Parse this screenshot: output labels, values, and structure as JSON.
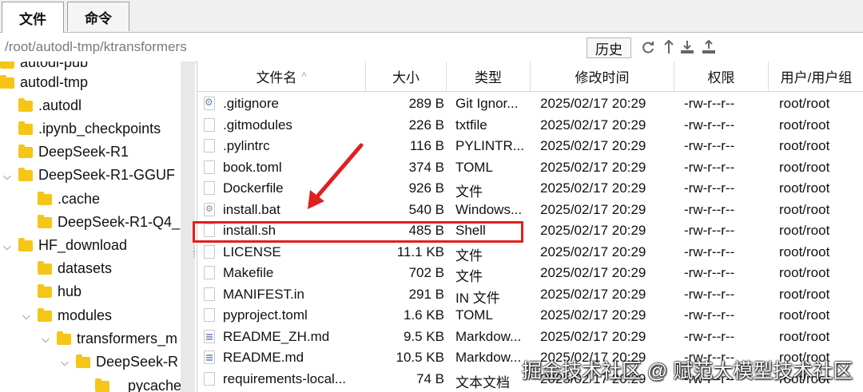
{
  "tabs": [
    {
      "label": "文件",
      "active": true
    },
    {
      "label": "命令",
      "active": false
    }
  ],
  "path": {
    "value": "/root/autodl-tmp/ktransformers",
    "history_label": "历史",
    "toolbar_icons": [
      "refresh-icon",
      "up-arrow-icon",
      "download-icon",
      "upload-icon"
    ]
  },
  "tree": {
    "items": [
      {
        "label": "autodl-pub"
      },
      {
        "label": "autodl-tmp"
      },
      {
        "label": ".autodl"
      },
      {
        "label": ".ipynb_checkpoints"
      },
      {
        "label": "DeepSeek-R1"
      },
      {
        "label": "DeepSeek-R1-GGUF"
      },
      {
        "label": ".cache"
      },
      {
        "label": "DeepSeek-R1-Q4_"
      },
      {
        "label": "HF_download"
      },
      {
        "label": "datasets"
      },
      {
        "label": "hub"
      },
      {
        "label": "modules"
      },
      {
        "label": "transformers_m"
      },
      {
        "label": "DeepSeek-R"
      },
      {
        "label": "pycache"
      }
    ]
  },
  "columns": [
    "文件名",
    "大小",
    "类型",
    "修改时间",
    "权限",
    "用户/用户组"
  ],
  "files": [
    {
      "name": ".gitignore",
      "size": "289 B",
      "type": "Git Ignor...",
      "modified": "2025/02/17 20:29",
      "perm": "-rw-r--r--",
      "owner": "root/root",
      "icon": "gear"
    },
    {
      "name": ".gitmodules",
      "size": "226 B",
      "type": "txtfile",
      "modified": "2025/02/17 20:29",
      "perm": "-rw-r--r--",
      "owner": "root/root",
      "icon": "plain"
    },
    {
      "name": ".pylintrc",
      "size": "116 B",
      "type": "PYLINTR...",
      "modified": "2025/02/17 20:29",
      "perm": "-rw-r--r--",
      "owner": "root/root",
      "icon": "plain"
    },
    {
      "name": "book.toml",
      "size": "374 B",
      "type": "TOML",
      "modified": "2025/02/17 20:29",
      "perm": "-rw-r--r--",
      "owner": "root/root",
      "icon": "plain"
    },
    {
      "name": "Dockerfile",
      "size": "926 B",
      "type": "文件",
      "modified": "2025/02/17 20:29",
      "perm": "-rw-r--r--",
      "owner": "root/root",
      "icon": "plain"
    },
    {
      "name": "install.bat",
      "size": "540 B",
      "type": "Windows...",
      "modified": "2025/02/17 20:29",
      "perm": "-rw-r--r--",
      "owner": "root/root",
      "icon": "bat"
    },
    {
      "name": "install.sh",
      "size": "485 B",
      "type": "Shell",
      "modified": "2025/02/17 20:29",
      "perm": "-rw-r--r--",
      "owner": "root/root",
      "icon": "plain"
    },
    {
      "name": "LICENSE",
      "size": "11.1 KB",
      "type": "文件",
      "modified": "2025/02/17 20:29",
      "perm": "-rw-r--r--",
      "owner": "root/root",
      "icon": "plain"
    },
    {
      "name": "Makefile",
      "size": "702 B",
      "type": "文件",
      "modified": "2025/02/17 20:29",
      "perm": "-rw-r--r--",
      "owner": "root/root",
      "icon": "plain"
    },
    {
      "name": "MANIFEST.in",
      "size": "291 B",
      "type": "IN 文件",
      "modified": "2025/02/17 20:29",
      "perm": "-rw-r--r--",
      "owner": "root/root",
      "icon": "plain"
    },
    {
      "name": "pyproject.toml",
      "size": "1.6 KB",
      "type": "TOML",
      "modified": "2025/02/17 20:29",
      "perm": "-rw-r--r--",
      "owner": "root/root",
      "icon": "plain"
    },
    {
      "name": "README_ZH.md",
      "size": "9.5 KB",
      "type": "Markdow...",
      "modified": "2025/02/17 20:29",
      "perm": "-rw-r--r--",
      "owner": "root/root",
      "icon": "doc"
    },
    {
      "name": "README.md",
      "size": "10.5 KB",
      "type": "Markdow...",
      "modified": "2025/02/17 20:29",
      "perm": "-rw-r--r--",
      "owner": "root/root",
      "icon": "doc"
    },
    {
      "name": "requirements-local...",
      "size": "74 B",
      "type": "文本文档",
      "modified": "2025/02/17 20:29",
      "perm": "-rw-r--r--",
      "owner": "root/root",
      "icon": "plain"
    }
  ],
  "annotation": {
    "highlighted_file": "install.sh",
    "color": "#e0201e"
  },
  "watermark": "掘金技术社区 @ 赋范大模型技术社区",
  "colors": {
    "folder": "#f5c518",
    "accent_red": "#e0201e"
  }
}
